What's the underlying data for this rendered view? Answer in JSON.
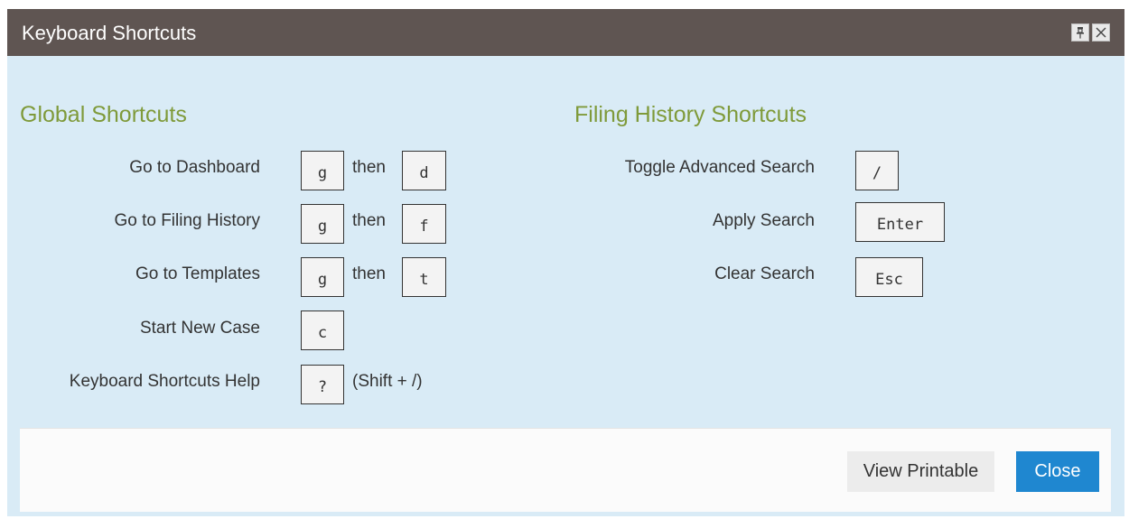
{
  "dialog": {
    "title": "Keyboard Shortcuts",
    "pin_icon": "pin-icon",
    "close_icon": "close-icon"
  },
  "global": {
    "heading": "Global Shortcuts",
    "items": [
      {
        "label": "Go to Dashboard",
        "key1": "g",
        "sep": "then",
        "key2": "d"
      },
      {
        "label": "Go to Filing History",
        "key1": "g",
        "sep": "then",
        "key2": "f"
      },
      {
        "label": "Go to Templates",
        "key1": "g",
        "sep": "then",
        "key2": "t"
      },
      {
        "label": "Start New Case",
        "key1": "c"
      },
      {
        "label": "Keyboard Shortcuts Help",
        "key1": "?",
        "note": "(Shift + /)"
      }
    ]
  },
  "filing": {
    "heading": "Filing History Shortcuts",
    "items": [
      {
        "label": "Toggle Advanced Search",
        "key1": "/"
      },
      {
        "label": "Apply Search",
        "key1": "Enter"
      },
      {
        "label": "Clear Search",
        "key1": "Esc"
      }
    ]
  },
  "footer": {
    "printable_label": "View Printable",
    "close_label": "Close"
  },
  "colors": {
    "titlebar": "#5f5552",
    "body": "#d9ebf6",
    "heading": "#7f9a3a",
    "primary_button": "#1f87d0"
  }
}
